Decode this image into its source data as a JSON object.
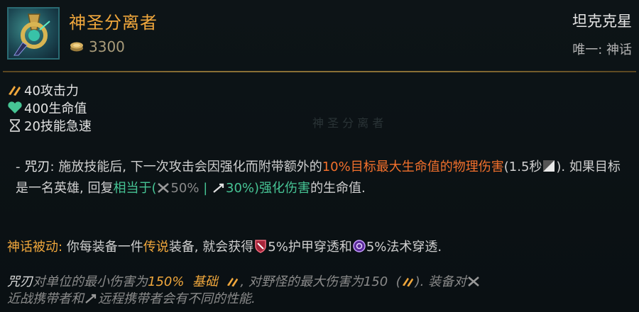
{
  "item": {
    "name": "神圣分离者",
    "cost": "3300",
    "champion": "坦克克星",
    "unique": "唯一: 神话"
  },
  "stats": [
    {
      "icon": "attack-damage-icon",
      "text": "40攻击力",
      "color": "#f0a73c"
    },
    {
      "icon": "health-icon",
      "text": "400生命值",
      "color": "#46c494"
    },
    {
      "icon": "ability-haste-icon",
      "text": "20技能急速",
      "color": "#cfcfcf"
    }
  ],
  "passive": {
    "dash": "-",
    "name": "咒刃",
    "p1": ": 施放技能后, 下一次攻击会因强化而附带额外的",
    "dmg": "10%目标最大生命值的物理伤害",
    "p2": "(1.5秒",
    "p3": "). 如果目标是一名英雄, 回复",
    "heal_pre": "相当于(",
    "melee_pct": "50%",
    "sep": " | ",
    "ranged_pct": "30%",
    "heal_post": ")强化伤害",
    "p4": "的生命值."
  },
  "mythic": {
    "label": "神话被动:",
    "pre": " 你每装备一件",
    "legendary": "传说",
    "mid": "装备, 就会获得",
    "armor_pen": "5%护甲穿透和",
    "magic_pen": "5%法术穿透."
  },
  "note": {
    "name": "咒刃",
    "t1": "对单位的最小伤害为",
    "pct": "150%",
    "base": "基础",
    "t2": ", 对野怪的最大伤害为150",
    "t3": "). 装备对",
    "t4": "近战携带者和",
    "t5": "远程携带者会有不同的性能."
  },
  "colors": {
    "gold": "#f0a73c",
    "orange_damage": "#f2702c",
    "green_heal": "#46c494",
    "divider": "#8a6f35"
  }
}
